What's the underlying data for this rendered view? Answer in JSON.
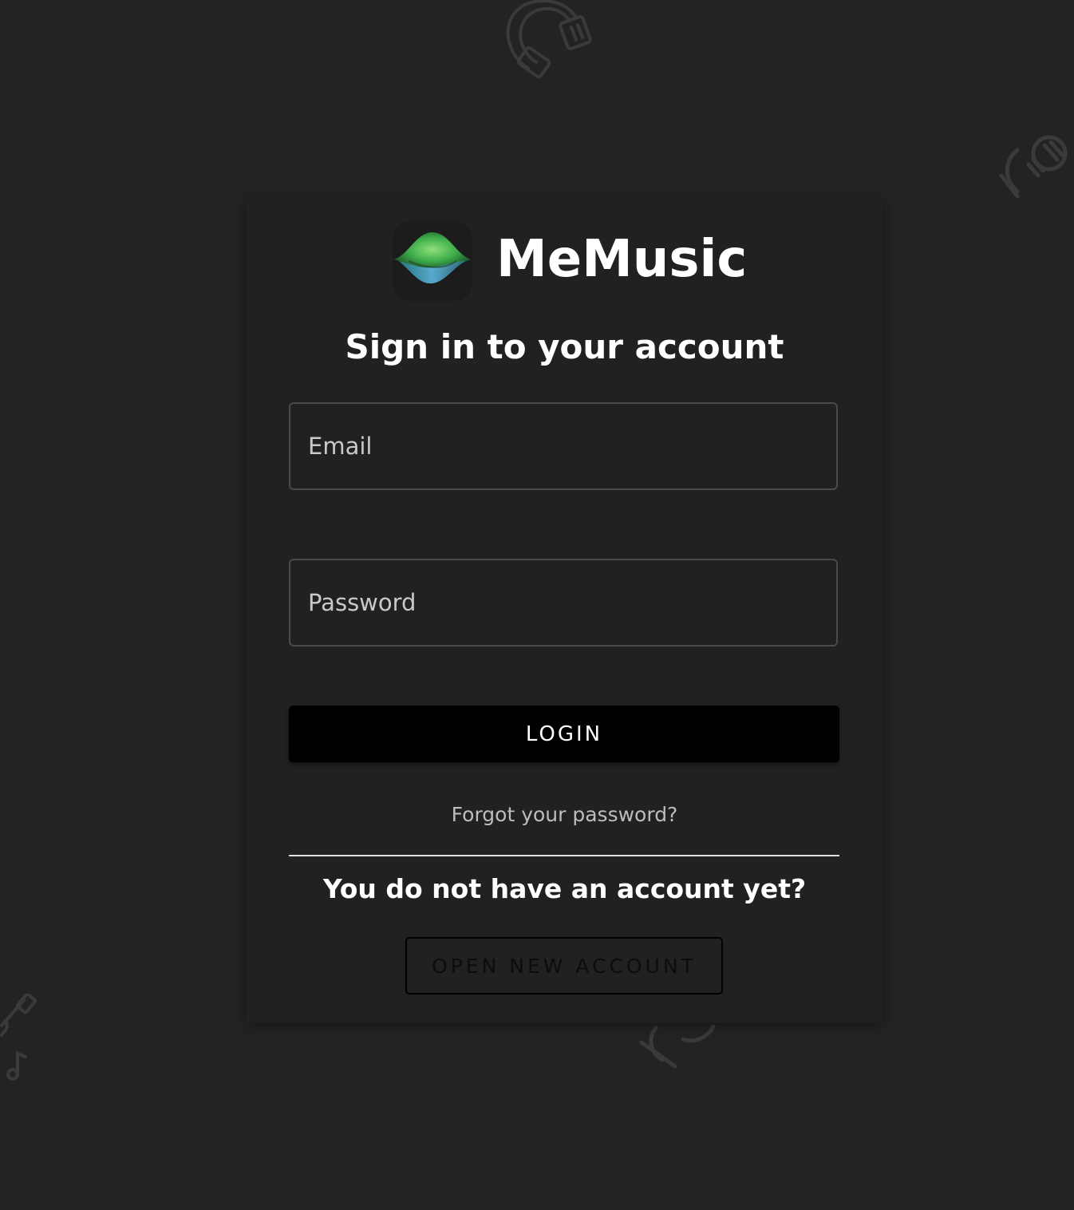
{
  "brand": {
    "name": "MeMusic"
  },
  "form": {
    "heading": "Sign in to your account",
    "email_placeholder": "Email",
    "password_placeholder": "Password",
    "login_label": "LOGIN",
    "forgot_label": "Forgot your password?",
    "no_account_text": "You do not have an account yet?",
    "open_account_label": "OPEN NEW ACCOUNT"
  },
  "colors": {
    "background": "#232323",
    "card": "#212121",
    "primary_button": "#000000",
    "text": "#ffffff",
    "logo_green": "#5cc15a",
    "logo_blue": "#4aa3c8"
  },
  "icons": [
    "headphones-icon",
    "microphone-icon",
    "guitar-icon",
    "music-note-icon"
  ]
}
